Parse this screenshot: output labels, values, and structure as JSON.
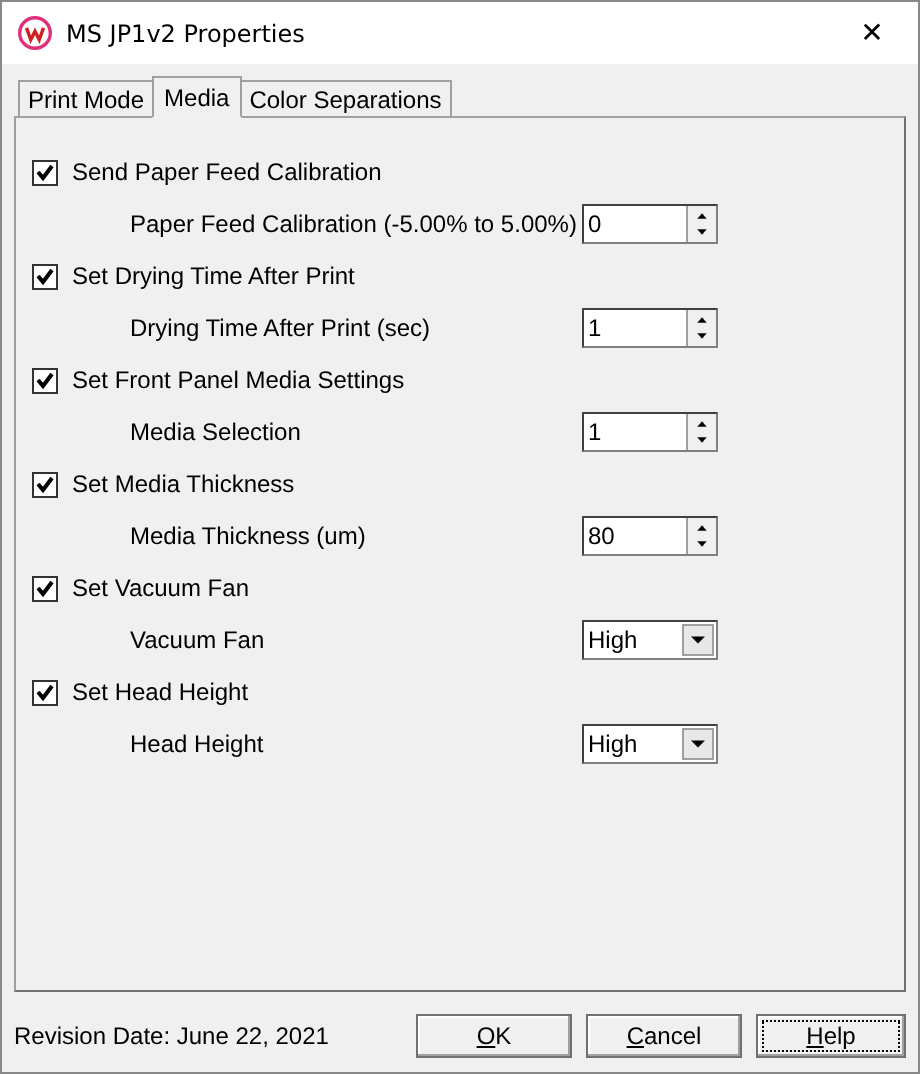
{
  "window": {
    "title": "MS JP1v2 Properties",
    "close": "✕"
  },
  "tabs": [
    {
      "label": "Print Mode",
      "selected": false
    },
    {
      "label": "Media",
      "selected": true
    },
    {
      "label": "Color Separations",
      "selected": false
    }
  ],
  "sections": [
    {
      "label": "Send Paper Feed Calibration",
      "checked": true,
      "setting": {
        "label": "Paper Feed Calibration (-5.00% to 5.00%)",
        "kind": "spin",
        "value": "0"
      }
    },
    {
      "label": "Set Drying Time After Print",
      "checked": true,
      "setting": {
        "label": "Drying Time After Print (sec)",
        "kind": "spin",
        "value": "1"
      }
    },
    {
      "label": "Set Front Panel Media Settings",
      "checked": true,
      "setting": {
        "label": "Media Selection",
        "kind": "spin",
        "value": "1"
      }
    },
    {
      "label": "Set Media Thickness",
      "checked": true,
      "setting": {
        "label": "Media Thickness (um)",
        "kind": "spin",
        "value": "80"
      }
    },
    {
      "label": "Set Vacuum Fan",
      "checked": true,
      "setting": {
        "label": "Vacuum Fan",
        "kind": "combo",
        "value": "High"
      }
    },
    {
      "label": "Set Head Height",
      "checked": true,
      "setting": {
        "label": "Head Height",
        "kind": "combo",
        "value": "High"
      }
    }
  ],
  "footer": {
    "revision": "Revision Date: June 22, 2021",
    "buttons": [
      {
        "label": "OK",
        "underline_first": true,
        "focused": false
      },
      {
        "label": "Cancel",
        "underline_first": true,
        "focused": false
      },
      {
        "label": "Help",
        "underline_first": true,
        "focused": true
      }
    ]
  }
}
